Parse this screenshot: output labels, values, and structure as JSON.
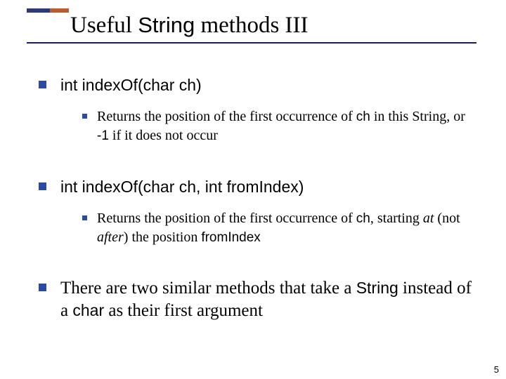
{
  "title": {
    "pre": "Useful ",
    "code": "String",
    "post": " methods III"
  },
  "items": [
    {
      "heading": {
        "full_code": "int indexOf(char ch)"
      },
      "sub": {
        "t1": "Returns the position of the first occurrence of ",
        "c1": "ch",
        "t2": " in this String, or ",
        "c2": "-1",
        "t3": " if it does not occur"
      }
    },
    {
      "heading": {
        "full_code": "int indexOf(char ch, int fromIndex)"
      },
      "sub": {
        "t1": "Returns the position of the first occurrence of ",
        "c1": "ch",
        "t2": ", starting ",
        "i1": "at",
        "t3": " (not ",
        "i2": "after",
        "t4": ") the position ",
        "c2": "fromIndex"
      }
    },
    {
      "heading": {
        "t1": "There are two similar methods that take a ",
        "c1": "String",
        "t2": " instead of a ",
        "c2": "char",
        "t3": " as their first argument"
      }
    }
  ],
  "page_number": "5"
}
